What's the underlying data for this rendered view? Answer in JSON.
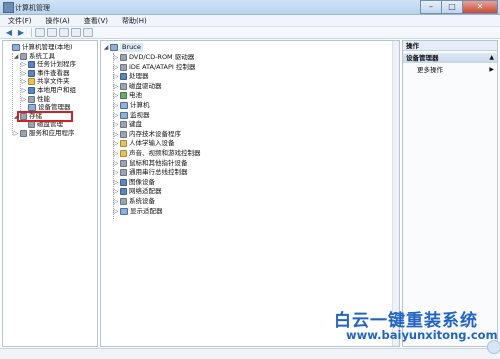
{
  "window": {
    "title": "计算机管理"
  },
  "menu": [
    "文件(F)",
    "操作(A)",
    "查看(V)",
    "帮助(H)"
  ],
  "left_tree": [
    {
      "label": "计算机管理(本地)",
      "depth": 0,
      "exp": "",
      "icon": "computer-icon",
      "color": "c-pc"
    },
    {
      "label": "系统工具",
      "depth": 1,
      "exp": "◢",
      "icon": "tools-icon",
      "color": "c-gray"
    },
    {
      "label": "任务计划程序",
      "depth": 2,
      "exp": "▷",
      "icon": "clock-icon",
      "color": "c-blue"
    },
    {
      "label": "事件查看器",
      "depth": 2,
      "exp": "▷",
      "icon": "event-viewer-icon",
      "color": "c-blue"
    },
    {
      "label": "共享文件夹",
      "depth": 2,
      "exp": "▷",
      "icon": "shared-folder-icon",
      "color": "c-yel"
    },
    {
      "label": "本地用户和组",
      "depth": 2,
      "exp": "▷",
      "icon": "users-icon",
      "color": "c-blue"
    },
    {
      "label": "性能",
      "depth": 2,
      "exp": "▷",
      "icon": "performance-icon",
      "color": "c-gray"
    },
    {
      "label": "设备管理器",
      "depth": 2,
      "exp": "",
      "icon": "device-manager-icon",
      "color": "c-pc"
    },
    {
      "label": "存储",
      "depth": 1,
      "exp": "◢",
      "icon": "storage-icon",
      "color": "c-gray"
    },
    {
      "label": "磁盘管理",
      "depth": 2,
      "exp": "",
      "icon": "disk-icon",
      "color": "c-gray"
    },
    {
      "label": "服务和应用程序",
      "depth": 1,
      "exp": "▷",
      "icon": "services-icon",
      "color": "c-gray"
    }
  ],
  "device_tree": {
    "root": "Bruce",
    "items": [
      "DVD/CD-ROM 驱动器",
      "IDE ATA/ATAPI 控制器",
      "处理器",
      "磁盘驱动器",
      "电池",
      "计算机",
      "监视器",
      "键盘",
      "内存技术设备程序",
      "人体学输入设备",
      "声音、视频和游戏控制器",
      "鼠标和其他指针设备",
      "通用串行总线控制器",
      "图像设备",
      "网络适配器",
      "系统设备",
      "显示适配器"
    ]
  },
  "actions": {
    "header": "操作",
    "section": "设备管理器",
    "more": "更多操作"
  },
  "watermark": {
    "line1": "白云一键重装系统",
    "line2": "www.baiyunxitong.com"
  }
}
